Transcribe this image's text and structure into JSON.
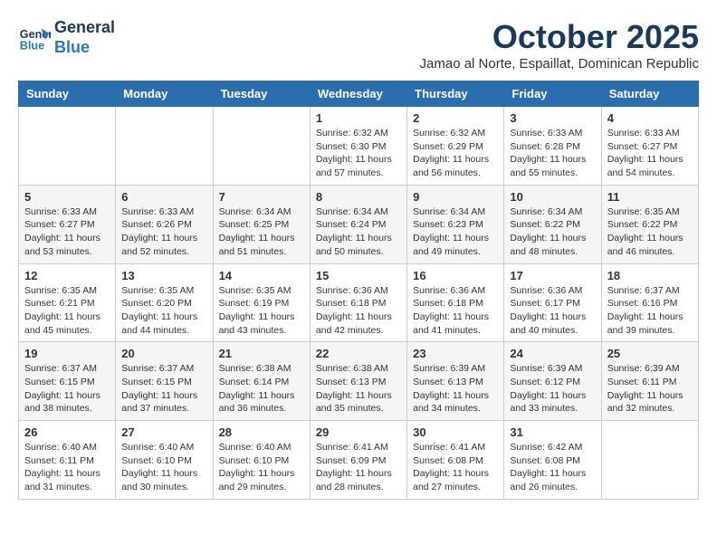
{
  "header": {
    "logo_line1": "General",
    "logo_line2": "Blue",
    "month_title": "October 2025",
    "location": "Jamao al Norte, Espaillat, Dominican Republic"
  },
  "days_of_week": [
    "Sunday",
    "Monday",
    "Tuesday",
    "Wednesday",
    "Thursday",
    "Friday",
    "Saturday"
  ],
  "weeks": [
    [
      {
        "day": "",
        "sunrise": "",
        "sunset": "",
        "daylight": ""
      },
      {
        "day": "",
        "sunrise": "",
        "sunset": "",
        "daylight": ""
      },
      {
        "day": "",
        "sunrise": "",
        "sunset": "",
        "daylight": ""
      },
      {
        "day": "1",
        "sunrise": "Sunrise: 6:32 AM",
        "sunset": "Sunset: 6:30 PM",
        "daylight": "Daylight: 11 hours and 57 minutes."
      },
      {
        "day": "2",
        "sunrise": "Sunrise: 6:32 AM",
        "sunset": "Sunset: 6:29 PM",
        "daylight": "Daylight: 11 hours and 56 minutes."
      },
      {
        "day": "3",
        "sunrise": "Sunrise: 6:33 AM",
        "sunset": "Sunset: 6:28 PM",
        "daylight": "Daylight: 11 hours and 55 minutes."
      },
      {
        "day": "4",
        "sunrise": "Sunrise: 6:33 AM",
        "sunset": "Sunset: 6:27 PM",
        "daylight": "Daylight: 11 hours and 54 minutes."
      }
    ],
    [
      {
        "day": "5",
        "sunrise": "Sunrise: 6:33 AM",
        "sunset": "Sunset: 6:27 PM",
        "daylight": "Daylight: 11 hours and 53 minutes."
      },
      {
        "day": "6",
        "sunrise": "Sunrise: 6:33 AM",
        "sunset": "Sunset: 6:26 PM",
        "daylight": "Daylight: 11 hours and 52 minutes."
      },
      {
        "day": "7",
        "sunrise": "Sunrise: 6:34 AM",
        "sunset": "Sunset: 6:25 PM",
        "daylight": "Daylight: 11 hours and 51 minutes."
      },
      {
        "day": "8",
        "sunrise": "Sunrise: 6:34 AM",
        "sunset": "Sunset: 6:24 PM",
        "daylight": "Daylight: 11 hours and 50 minutes."
      },
      {
        "day": "9",
        "sunrise": "Sunrise: 6:34 AM",
        "sunset": "Sunset: 6:23 PM",
        "daylight": "Daylight: 11 hours and 49 minutes."
      },
      {
        "day": "10",
        "sunrise": "Sunrise: 6:34 AM",
        "sunset": "Sunset: 6:22 PM",
        "daylight": "Daylight: 11 hours and 48 minutes."
      },
      {
        "day": "11",
        "sunrise": "Sunrise: 6:35 AM",
        "sunset": "Sunset: 6:22 PM",
        "daylight": "Daylight: 11 hours and 46 minutes."
      }
    ],
    [
      {
        "day": "12",
        "sunrise": "Sunrise: 6:35 AM",
        "sunset": "Sunset: 6:21 PM",
        "daylight": "Daylight: 11 hours and 45 minutes."
      },
      {
        "day": "13",
        "sunrise": "Sunrise: 6:35 AM",
        "sunset": "Sunset: 6:20 PM",
        "daylight": "Daylight: 11 hours and 44 minutes."
      },
      {
        "day": "14",
        "sunrise": "Sunrise: 6:35 AM",
        "sunset": "Sunset: 6:19 PM",
        "daylight": "Daylight: 11 hours and 43 minutes."
      },
      {
        "day": "15",
        "sunrise": "Sunrise: 6:36 AM",
        "sunset": "Sunset: 6:18 PM",
        "daylight": "Daylight: 11 hours and 42 minutes."
      },
      {
        "day": "16",
        "sunrise": "Sunrise: 6:36 AM",
        "sunset": "Sunset: 6:18 PM",
        "daylight": "Daylight: 11 hours and 41 minutes."
      },
      {
        "day": "17",
        "sunrise": "Sunrise: 6:36 AM",
        "sunset": "Sunset: 6:17 PM",
        "daylight": "Daylight: 11 hours and 40 minutes."
      },
      {
        "day": "18",
        "sunrise": "Sunrise: 6:37 AM",
        "sunset": "Sunset: 6:16 PM",
        "daylight": "Daylight: 11 hours and 39 minutes."
      }
    ],
    [
      {
        "day": "19",
        "sunrise": "Sunrise: 6:37 AM",
        "sunset": "Sunset: 6:15 PM",
        "daylight": "Daylight: 11 hours and 38 minutes."
      },
      {
        "day": "20",
        "sunrise": "Sunrise: 6:37 AM",
        "sunset": "Sunset: 6:15 PM",
        "daylight": "Daylight: 11 hours and 37 minutes."
      },
      {
        "day": "21",
        "sunrise": "Sunrise: 6:38 AM",
        "sunset": "Sunset: 6:14 PM",
        "daylight": "Daylight: 11 hours and 36 minutes."
      },
      {
        "day": "22",
        "sunrise": "Sunrise: 6:38 AM",
        "sunset": "Sunset: 6:13 PM",
        "daylight": "Daylight: 11 hours and 35 minutes."
      },
      {
        "day": "23",
        "sunrise": "Sunrise: 6:39 AM",
        "sunset": "Sunset: 6:13 PM",
        "daylight": "Daylight: 11 hours and 34 minutes."
      },
      {
        "day": "24",
        "sunrise": "Sunrise: 6:39 AM",
        "sunset": "Sunset: 6:12 PM",
        "daylight": "Daylight: 11 hours and 33 minutes."
      },
      {
        "day": "25",
        "sunrise": "Sunrise: 6:39 AM",
        "sunset": "Sunset: 6:11 PM",
        "daylight": "Daylight: 11 hours and 32 minutes."
      }
    ],
    [
      {
        "day": "26",
        "sunrise": "Sunrise: 6:40 AM",
        "sunset": "Sunset: 6:11 PM",
        "daylight": "Daylight: 11 hours and 31 minutes."
      },
      {
        "day": "27",
        "sunrise": "Sunrise: 6:40 AM",
        "sunset": "Sunset: 6:10 PM",
        "daylight": "Daylight: 11 hours and 30 minutes."
      },
      {
        "day": "28",
        "sunrise": "Sunrise: 6:40 AM",
        "sunset": "Sunset: 6:10 PM",
        "daylight": "Daylight: 11 hours and 29 minutes."
      },
      {
        "day": "29",
        "sunrise": "Sunrise: 6:41 AM",
        "sunset": "Sunset: 6:09 PM",
        "daylight": "Daylight: 11 hours and 28 minutes."
      },
      {
        "day": "30",
        "sunrise": "Sunrise: 6:41 AM",
        "sunset": "Sunset: 6:08 PM",
        "daylight": "Daylight: 11 hours and 27 minutes."
      },
      {
        "day": "31",
        "sunrise": "Sunrise: 6:42 AM",
        "sunset": "Sunset: 6:08 PM",
        "daylight": "Daylight: 11 hours and 26 minutes."
      },
      {
        "day": "",
        "sunrise": "",
        "sunset": "",
        "daylight": ""
      }
    ]
  ]
}
